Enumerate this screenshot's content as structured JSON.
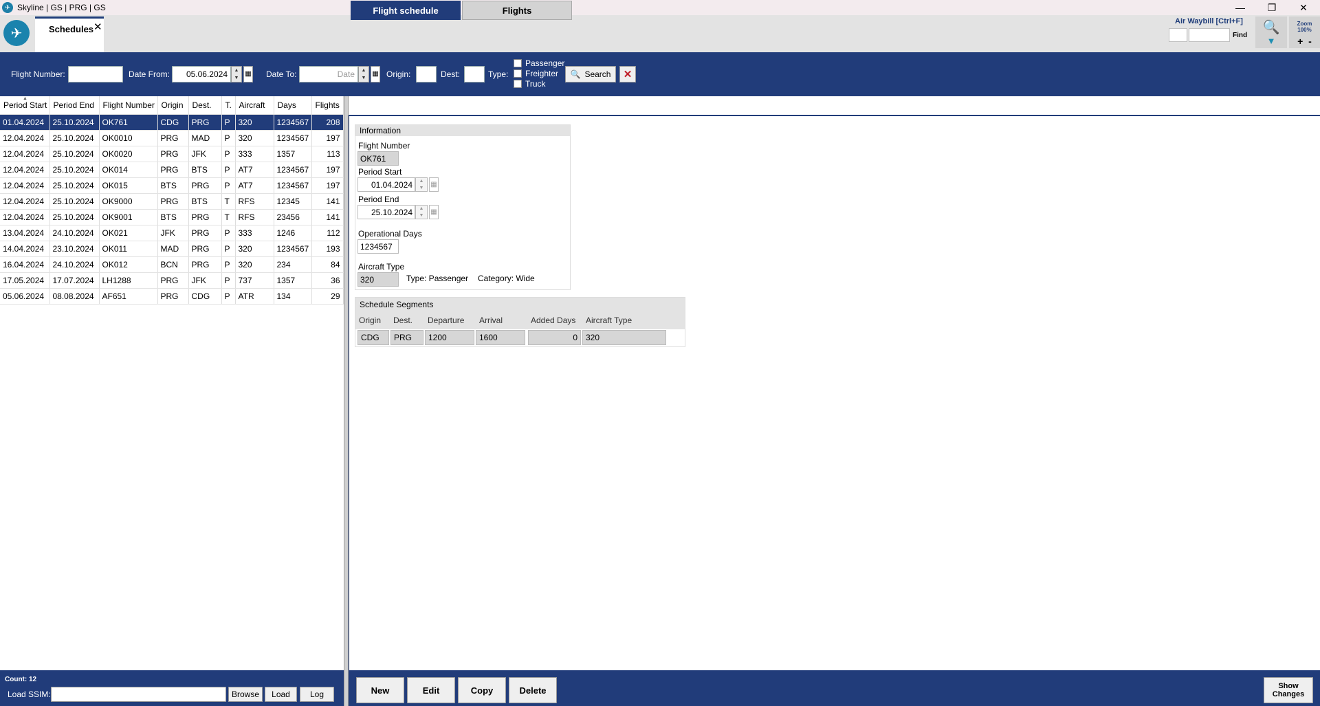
{
  "window": {
    "title": "Skyline | GS | PRG | GS"
  },
  "tab": {
    "label": "Schedules"
  },
  "awb": {
    "label": "Air Waybill [Ctrl+F]",
    "find": "Find"
  },
  "zoom": {
    "label": "Zoom",
    "value": "100%"
  },
  "filters": {
    "flight_number_label": "Flight Number:",
    "flight_number": "",
    "date_from_label": "Date From:",
    "date_from": "05.06.2024",
    "date_to_label": "Date To:",
    "date_to_placeholder": "Date",
    "origin_label": "Origin:",
    "dest_label": "Dest:",
    "type_label": "Type:",
    "types": [
      "Passenger",
      "Freighter",
      "Truck"
    ],
    "search_label": "Search"
  },
  "list": {
    "columns": [
      "Period Start",
      "Period End",
      "Flight Number",
      "Origin",
      "Dest.",
      "T.",
      "Aircraft",
      "Days",
      "Flights"
    ],
    "rows": [
      [
        "01.04.2024",
        "25.10.2024",
        "OK761",
        "CDG",
        "PRG",
        "P",
        "320",
        "1234567",
        "208"
      ],
      [
        "12.04.2024",
        "25.10.2024",
        "OK0010",
        "PRG",
        "MAD",
        "P",
        "320",
        "1234567",
        "197"
      ],
      [
        "12.04.2024",
        "25.10.2024",
        "OK0020",
        "PRG",
        "JFK",
        "P",
        "333",
        "1357",
        "113"
      ],
      [
        "12.04.2024",
        "25.10.2024",
        "OK014",
        "PRG",
        "BTS",
        "P",
        "AT7",
        "1234567",
        "197"
      ],
      [
        "12.04.2024",
        "25.10.2024",
        "OK015",
        "BTS",
        "PRG",
        "P",
        "AT7",
        "1234567",
        "197"
      ],
      [
        "12.04.2024",
        "25.10.2024",
        "OK9000",
        "PRG",
        "BTS",
        "T",
        "RFS",
        "12345",
        "141"
      ],
      [
        "12.04.2024",
        "25.10.2024",
        "OK9001",
        "BTS",
        "PRG",
        "T",
        "RFS",
        "23456",
        "141"
      ],
      [
        "13.04.2024",
        "24.10.2024",
        "OK021",
        "JFK",
        "PRG",
        "P",
        "333",
        "1246",
        "112"
      ],
      [
        "14.04.2024",
        "23.10.2024",
        "OK011",
        "MAD",
        "PRG",
        "P",
        "320",
        "1234567",
        "193"
      ],
      [
        "16.04.2024",
        "24.10.2024",
        "OK012",
        "BCN",
        "PRG",
        "P",
        "320",
        "234",
        "84"
      ],
      [
        "17.05.2024",
        "17.07.2024",
        "LH1288",
        "PRG",
        "JFK",
        "P",
        "737",
        "1357",
        "36"
      ],
      [
        "05.06.2024",
        "08.08.2024",
        "AF651",
        "PRG",
        "CDG",
        "P",
        "ATR",
        "134",
        "29"
      ]
    ],
    "count": "Count: 12",
    "ssim_label": "Load SSIM:",
    "browse": "Browse",
    "load": "Load",
    "log": "Log"
  },
  "detail_tabs": [
    "Flight schedule",
    "Flights"
  ],
  "info": {
    "header": "Information",
    "flight_number_label": "Flight Number",
    "flight_number": "OK761",
    "period_start_label": "Period Start",
    "period_start": "01.04.2024",
    "period_end_label": "Period End",
    "period_end": "25.10.2024",
    "op_days_label": "Operational Days",
    "op_days": "1234567",
    "aircraft_type_label": "Aircraft Type",
    "aircraft_type": "320",
    "type": "Type: Passenger",
    "category": "Category: Wide"
  },
  "segments": {
    "header": "Schedule Segments",
    "columns": [
      "Origin",
      "Dest.",
      "Departure",
      "Arrival",
      "Added Days",
      "Aircraft Type"
    ],
    "row": [
      "CDG",
      "PRG",
      "1200",
      "1600",
      "0",
      "320"
    ]
  },
  "actions": {
    "new": "New",
    "edit": "Edit",
    "copy": "Copy",
    "delete": "Delete",
    "show_changes": "Show Changes"
  },
  "colors": {
    "navy": "#213c7a",
    "selected_row": "#213c7a"
  }
}
